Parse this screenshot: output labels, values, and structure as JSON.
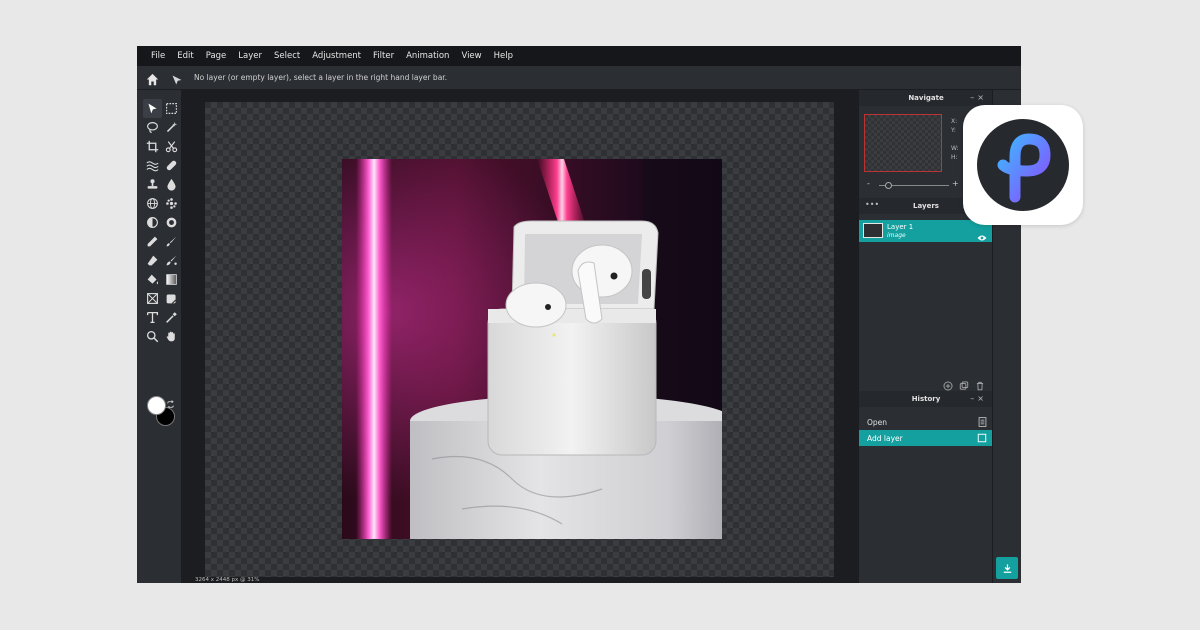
{
  "menu": {
    "items": [
      "File",
      "Edit",
      "Page",
      "Layer",
      "Select",
      "Adjustment",
      "Filter",
      "Animation",
      "View",
      "Help"
    ]
  },
  "options_bar": {
    "hint": "No layer (or empty layer), select a layer in the right hand layer bar."
  },
  "status": {
    "info": "3264 x 2448 px @ 31%"
  },
  "navigate": {
    "title": "Navigate",
    "x_label": "X:",
    "y_label": "Y:",
    "w_label": "W:",
    "h_label": "H:",
    "zoom_minus": "-",
    "zoom_plus": "+"
  },
  "layers": {
    "title": "Layers",
    "items": [
      {
        "name": "Layer 1",
        "type": "image"
      }
    ]
  },
  "history": {
    "title": "History",
    "items": [
      "Open",
      "Add layer"
    ],
    "active_index": 1
  },
  "colors": {
    "accent": "#13a09f",
    "foreground": "#ffffff",
    "background": "#000000"
  },
  "icons": {
    "logo": "pixlr-logo-icon",
    "download": "download-icon"
  }
}
